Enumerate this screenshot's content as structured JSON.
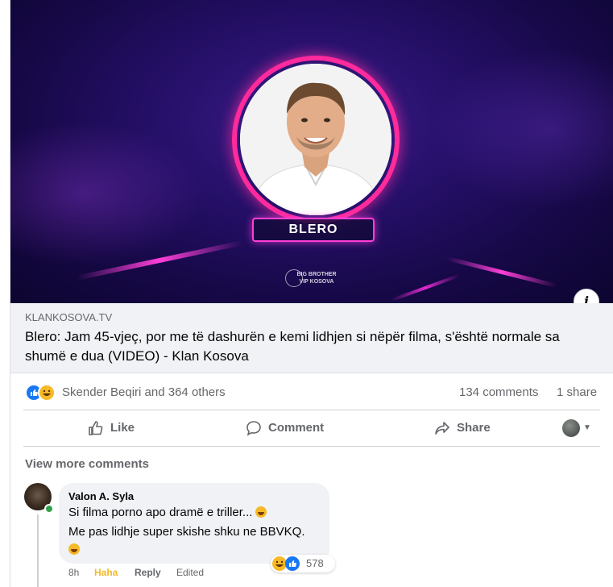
{
  "hero": {
    "name_tag": "BLERO",
    "show_logo_line1": "BIG BROTHER",
    "show_logo_line2": "VIP KOSOVA"
  },
  "link_preview": {
    "domain": "KLANKOSOVA.TV",
    "title": "Blero: Jam 45-vjeç, por me të dashurën e kemi lidhjen si nëpër filma, s'është normale sa shumë e dua (VIDEO) - Klan Kosova"
  },
  "stats": {
    "reactors": "Skender Beqiri and 364 others",
    "comments": "134 comments",
    "shares": "1 share",
    "reaction_icons": [
      "like-icon",
      "haha-icon"
    ]
  },
  "actions": {
    "like": "Like",
    "comment": "Comment",
    "share": "Share"
  },
  "comments_section": {
    "view_more": "View more comments",
    "comment": {
      "author": "Valon A. Syla",
      "line1": "Si filma porno apo dramë e triller...",
      "line2": "Me pas lidhje super skishe shku ne BBVKQ.",
      "reaction_count": "578",
      "time": "8h",
      "reaction_label": "Haha",
      "reply": "Reply",
      "edited": "Edited"
    }
  },
  "colors": {
    "facebook_blue": "#1877f2",
    "haha_yellow": "#f7b928",
    "secondary_text": "#65676b",
    "link_bg": "#f0f2f5",
    "neon_pink": "#ff2a9c"
  }
}
